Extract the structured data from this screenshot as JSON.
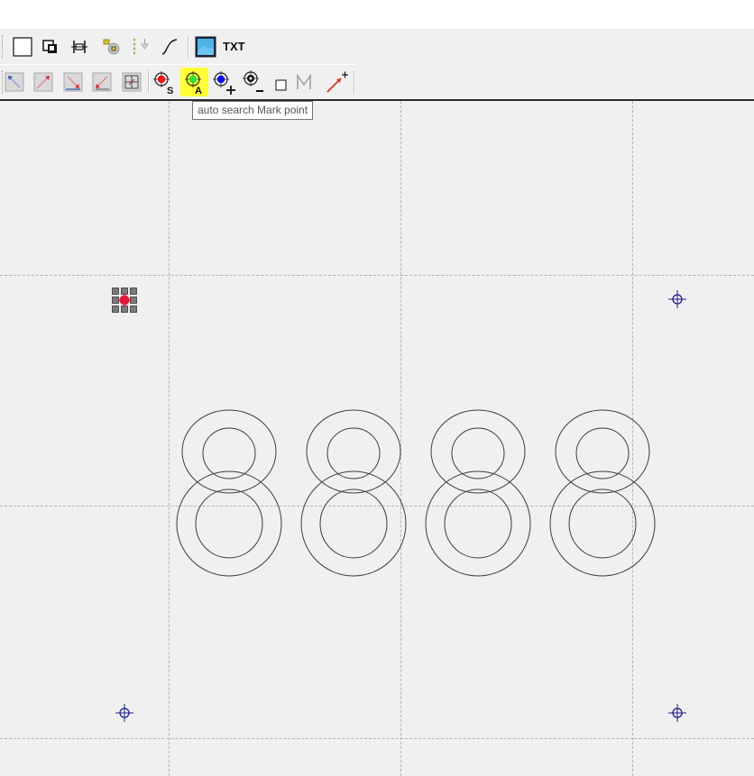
{
  "toolbar": {
    "row1": {
      "buttons": [
        {
          "name": "new-rectangle-button",
          "icon": "rectangle-icon"
        },
        {
          "name": "layer-order-button",
          "icon": "layers-icon"
        },
        {
          "name": "align-button",
          "icon": "align-icon"
        },
        {
          "name": "node-button",
          "icon": "node-icon"
        },
        {
          "name": "sort-button",
          "icon": "sort-icon"
        },
        {
          "name": "curve-button",
          "icon": "curve-icon"
        },
        {
          "name": "image-button",
          "icon": "image-icon"
        }
      ],
      "txt_label": "TXT"
    },
    "row2": {
      "buttons": [
        {
          "name": "align-top-left-button",
          "icon": "arrow-top-left-icon"
        },
        {
          "name": "align-top-right-button",
          "icon": "arrow-top-right-icon"
        },
        {
          "name": "align-bottom-right-button",
          "icon": "arrow-bottom-right-icon"
        },
        {
          "name": "align-bottom-left-button",
          "icon": "arrow-bottom-left-icon"
        },
        {
          "name": "align-center-button",
          "icon": "center-grid-icon"
        },
        {
          "name": "set-mark-point-button",
          "icon": "mark-red-icon",
          "subscript": "S"
        },
        {
          "name": "auto-search-mark-button",
          "icon": "mark-green-icon",
          "subscript": "A",
          "highlighted": true
        },
        {
          "name": "add-mark-button",
          "icon": "mark-blue-icon",
          "subscript": "+"
        },
        {
          "name": "remove-mark-button",
          "icon": "mark-black-icon",
          "subscript": "-"
        },
        {
          "name": "mark-box-button",
          "icon": "square-icon"
        },
        {
          "name": "mark-m-button",
          "icon": "letter-m-icon",
          "label": "M"
        },
        {
          "name": "mark-line-button",
          "icon": "red-line-plus-icon"
        }
      ]
    }
  },
  "tooltip": {
    "text": "auto search Mark point"
  },
  "canvas": {
    "text_object": "8888",
    "colors": {
      "background": "#f0f0f0",
      "grid": "#b4b4b4",
      "outline": "#3c3c3c",
      "mark_crosshair": "#1b1b8a",
      "selected_mark": "#e0183a",
      "highlight": "#ffff33"
    }
  }
}
